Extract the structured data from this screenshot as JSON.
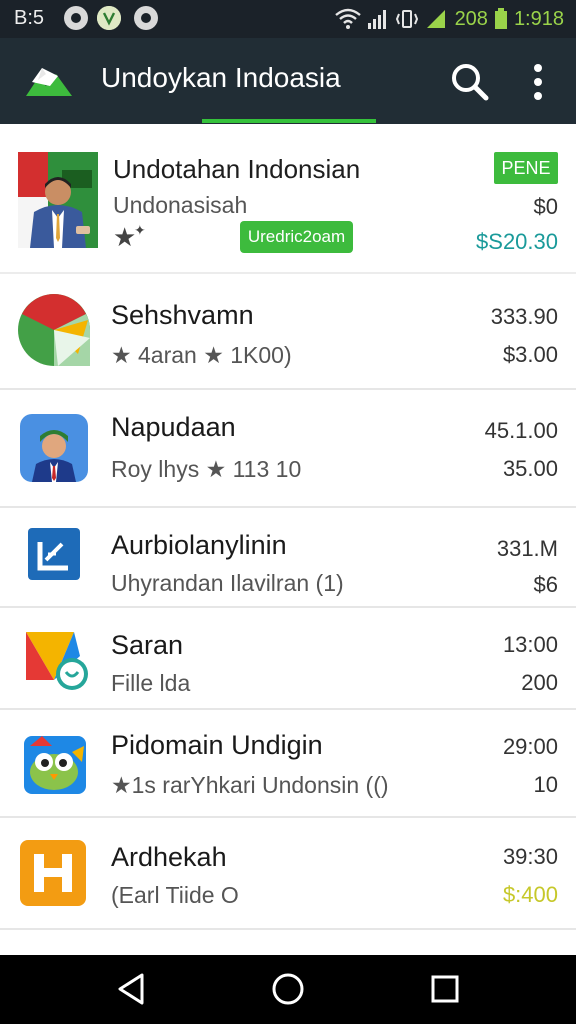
{
  "status_bar": {
    "time": "B:5",
    "battery_percent": "208",
    "clock": "1:918",
    "icons": [
      "notification-dot-icon",
      "vine-icon",
      "notification-dot-icon",
      "wifi-icon",
      "signal-icon",
      "vibrate-icon",
      "signal-icon",
      "battery-icon"
    ]
  },
  "app_bar": {
    "title": "Undoykan Indoasia",
    "accent_color": "#35c23b",
    "background_color": "#212d35"
  },
  "featured": {
    "title": "Undotahan Indonsian",
    "subtitle": "Undonasisah",
    "corner_badge": "PENE",
    "pill_badge": "Uredric2oam",
    "price_top": "$0",
    "price_bottom": "$S20.30",
    "badge_color": "#3dbb3d"
  },
  "apps": [
    {
      "name": "Sehshvamn",
      "meta": "★ 4aran ★ 1K00)",
      "price_top": "333.90",
      "price_bottom": "$3.00",
      "icon": "chrome-like-icon"
    },
    {
      "name": "Napudaan",
      "meta": "Roy lhys ★ 113 10",
      "price_top": "45.1.00",
      "price_bottom": "35.00",
      "icon": "avatar-icon"
    },
    {
      "name": "Aurbiolanylinin",
      "meta": "Uhyrandan Ilavilran (1)",
      "price_top": "331.M",
      "price_bottom": "$6",
      "icon": "edit-square-icon"
    },
    {
      "name": "Saran",
      "meta": "Fille lda",
      "price_top": "13:00",
      "price_bottom": "200",
      "icon": "play-triangle-icon"
    },
    {
      "name": "Pidomain Undigin",
      "meta": "★1s rarYhkari Undonsin (()",
      "price_top": "29:00",
      "price_bottom": "10",
      "icon": "owl-icon"
    },
    {
      "name": "Ardhekah",
      "meta": "(Earl Tiide O",
      "price_top": "39:30",
      "price_bottom": "$:400",
      "icon": "orange-h-icon",
      "price_bottom_color": "#c6c82a"
    }
  ],
  "nav_bar": {
    "back": "back-icon",
    "home": "home-icon",
    "recents": "recents-icon"
  }
}
